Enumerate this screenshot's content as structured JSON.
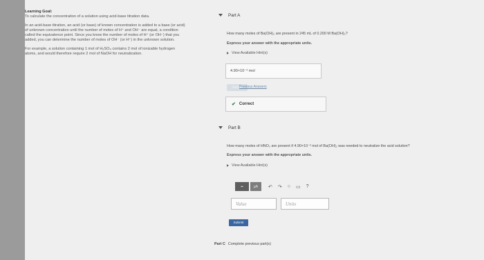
{
  "learning_goal": {
    "title": "Learning Goal:",
    "objective": "To calculate the concentration of a solution using acid-base titration data.",
    "paragraph1": "In an acid-base titration, an acid (or base) of known concentration is added to a base (or acid) of unknown concentration until the number of moles of H⁺ and OH⁻ are equal, a condition called the equivalence point. Since you know the number of moles of H⁺ (or OH⁻) that you added, you can determine the number of moles of OH⁻ (or H⁺) in the unknown solution.",
    "paragraph2": "For example, a solution containing 1 mol of H₂SO₄ contains 2 mol of ionizable hydrogen atoms, and would therefore require 2 mol of NaOH for neutralization."
  },
  "part_a": {
    "header": "Part A",
    "question": "How many moles of Ba(OH)₂ are present in 245 mL of 0.200 M Ba(OH)₂?",
    "instruction": "Express your answer with the appropriate units.",
    "hints": "View Available Hint(s)",
    "answer_value": "4.90×10⁻² mol",
    "submit_label": "Submit",
    "previous_answers": "Previous Answers",
    "result": "Correct"
  },
  "part_b": {
    "header": "Part B",
    "question": "How many moles of HNO₃ are present if 4.90×10⁻² mol of Ba(OH)₂ was needed to neutralize the acid solution?",
    "instruction": "Express your answer with the appropriate units.",
    "hints": "View Available Hint(s)",
    "toolbar": [
      "▪▪",
      "μA"
    ],
    "toolbar_icons": [
      "↶",
      "↷",
      "○",
      "▭",
      "?"
    ],
    "value_placeholder": "Value",
    "units_placeholder": "Units",
    "submit_label": "Submit"
  },
  "part_c": {
    "label": "Part C",
    "status": "Complete previous part(s)"
  }
}
